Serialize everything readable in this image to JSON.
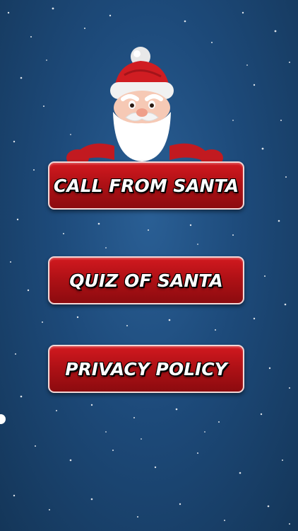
{
  "menu": {
    "call_label": "CALL FROM SANTA",
    "quiz_label": "QUIZ OF SANTA",
    "privacy_label": "PRIVACY POLICY"
  },
  "icons": {
    "mascot": "santa-mascot-icon"
  },
  "colors": {
    "background": "#1d4a7a",
    "button_red": "#b01116",
    "button_border": "#f2d6d6",
    "text": "#ffffff"
  }
}
